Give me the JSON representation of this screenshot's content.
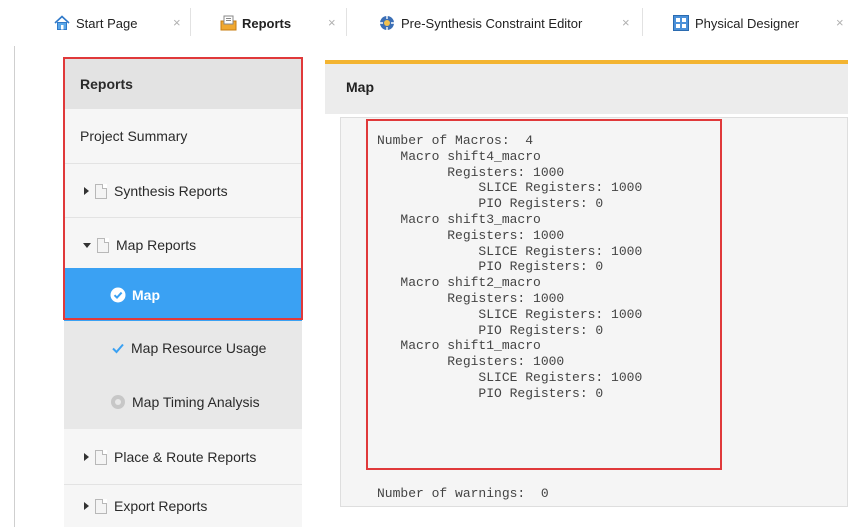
{
  "tabs": [
    {
      "label": "Start Page",
      "icon": "home-icon"
    },
    {
      "label": "Reports",
      "icon": "reports-icon",
      "active": true
    },
    {
      "label": "Pre-Synthesis Constraint Editor",
      "icon": "constraint-editor-icon"
    },
    {
      "label": "Physical Designer",
      "icon": "physical-designer-icon"
    }
  ],
  "close_glyph": "×",
  "sidebar": {
    "header": "Reports",
    "items": [
      {
        "label": "Project Summary"
      },
      {
        "label": "Synthesis Reports"
      },
      {
        "label": "Map Reports"
      },
      {
        "label": "Map"
      },
      {
        "label": "Map Resource Usage"
      },
      {
        "label": "Map Timing Analysis"
      },
      {
        "label": "Place & Route Reports"
      },
      {
        "label": "Export Reports"
      }
    ]
  },
  "main": {
    "title": "Map",
    "report": {
      "lines": [
        "Number of Macros:  4",
        "   Macro shift4_macro",
        "         Registers: 1000",
        "             SLICE Registers: 1000",
        "             PIO Registers: 0",
        "   Macro shift3_macro",
        "         Registers: 1000",
        "             SLICE Registers: 1000",
        "             PIO Registers: 0",
        "   Macro shift2_macro",
        "         Registers: 1000",
        "             SLICE Registers: 1000",
        "             PIO Registers: 0",
        "   Macro shift1_macro",
        "         Registers: 1000",
        "             SLICE Registers: 1000",
        "             PIO Registers: 0"
      ],
      "warnings": "Number of warnings:  0"
    }
  },
  "colors": {
    "selected": "#3aa1f3",
    "highlight_box": "#e0393a",
    "accent_bar": "#f3b431"
  }
}
